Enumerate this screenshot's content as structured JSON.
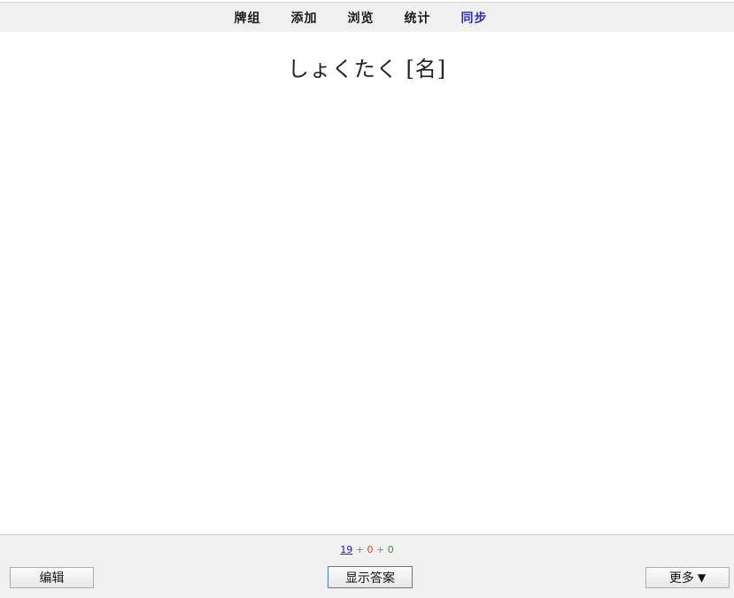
{
  "toolbar": {
    "items": [
      {
        "label": "牌组"
      },
      {
        "label": "添加"
      },
      {
        "label": "浏览"
      },
      {
        "label": "统计"
      },
      {
        "label": "同步"
      }
    ],
    "sync_color": "#2f2fb8"
  },
  "card": {
    "question": "しょくたく [名]"
  },
  "counts": {
    "new": "19",
    "learn": "0",
    "review": "0",
    "separator": "+"
  },
  "buttons": {
    "edit": "编辑",
    "show_answer": "显示答案",
    "more": "更多",
    "more_arrow": "▼"
  },
  "colors": {
    "new": "#1a1ad0",
    "learn": "#cc4422",
    "review": "#2a9a2a"
  }
}
